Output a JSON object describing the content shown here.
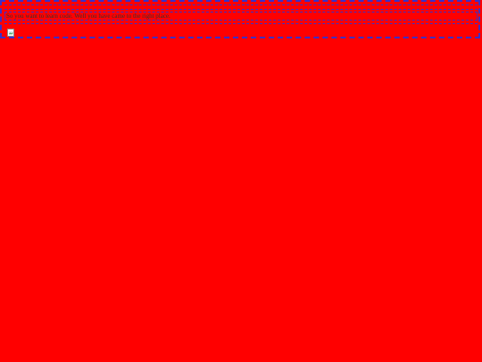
{
  "page": {
    "background_color": "#ff0000",
    "border_color": "#3a2fc9"
  },
  "content": {
    "intro_text": "So you want to learn code. Well you have came to the right place.",
    "image_icon": "broken-image-icon"
  }
}
